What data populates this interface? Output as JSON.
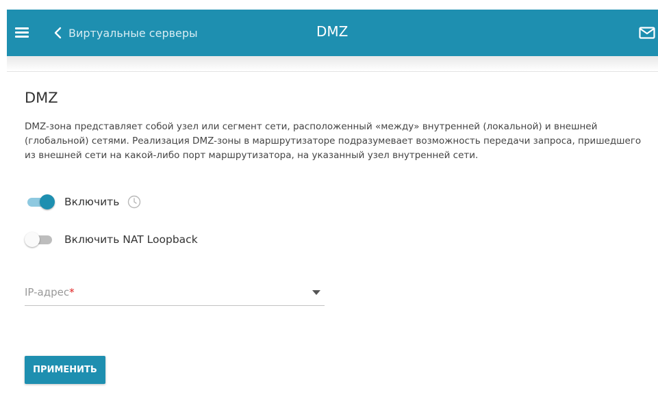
{
  "header": {
    "back_label": "Виртуальные серверы",
    "title": "DMZ",
    "color": "#1e8fb0"
  },
  "section": {
    "title": "DMZ",
    "description": "DMZ-зона представляет собой узел или сегмент сети, расположенный «между» внутренней (локальной) и внешней (глобальной) сетями. Реализация DMZ-зоны в маршрутизаторе подразумевает возможность передачи запроса, пришедшего из внешней сети на какой-либо порт маршрутизатора, на указанный узел внутренней сети."
  },
  "toggles": {
    "enable": {
      "label": "Включить",
      "state": "on"
    },
    "nat_loopback": {
      "label": "Включить NAT Loopback",
      "state": "off"
    }
  },
  "ip_field": {
    "label": "IP-адрес",
    "required_mark": "*",
    "value": ""
  },
  "apply_button": {
    "label": "ПРИМЕНИТЬ"
  },
  "icons": {
    "menu": "hamburger-menu-icon",
    "back": "chevron-left-icon",
    "mail": "mail-icon",
    "schedule": "clock-icon",
    "dropdown": "caret-down-icon"
  }
}
